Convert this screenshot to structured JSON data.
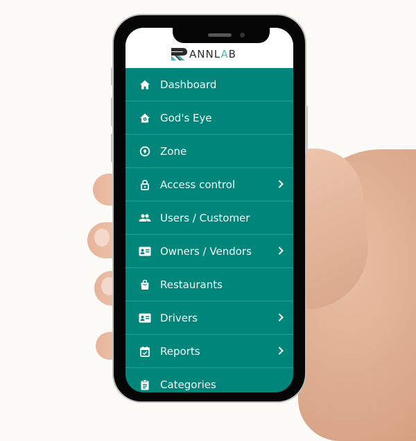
{
  "app": {
    "brand": {
      "name_prefix": "ANNL",
      "name_accent": "A",
      "name_suffix": "B",
      "logo_letter": "R"
    },
    "colors": {
      "primary": "#00857a",
      "header": "#ffffff",
      "logo_dark": "#2b2b2b",
      "logo_accent": "#4cb8b6"
    }
  },
  "menu": {
    "items": [
      {
        "label": "Dashboard",
        "icon": "home-icon",
        "has_submenu": false
      },
      {
        "label": "God's Eye",
        "icon": "eye-house-icon",
        "has_submenu": false
      },
      {
        "label": "Zone",
        "icon": "location-pin-icon",
        "has_submenu": false
      },
      {
        "label": "Access control",
        "icon": "lock-icon",
        "has_submenu": true
      },
      {
        "label": "Users / Customer",
        "icon": "users-icon",
        "has_submenu": false
      },
      {
        "label": "Owners / Vendors",
        "icon": "id-card-icon",
        "has_submenu": true
      },
      {
        "label": "Restaurants",
        "icon": "shopping-bag-icon",
        "has_submenu": false
      },
      {
        "label": "Drivers",
        "icon": "id-card-icon",
        "has_submenu": true
      },
      {
        "label": "Reports",
        "icon": "calendar-check-icon",
        "has_submenu": true
      },
      {
        "label": "Categories",
        "icon": "clipboard-icon",
        "has_submenu": false
      }
    ]
  }
}
